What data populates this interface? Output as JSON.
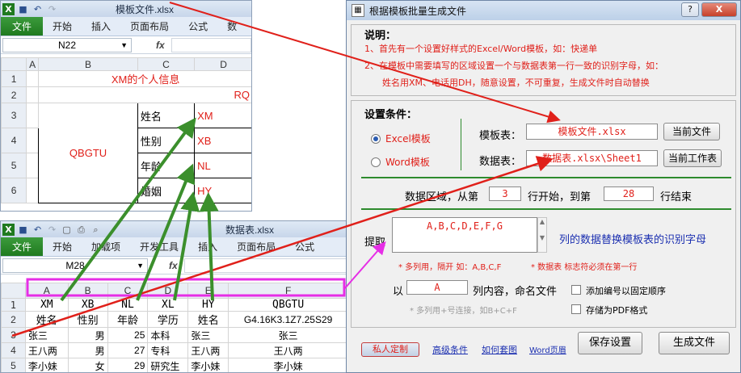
{
  "template_window": {
    "title": "模板文件.xlsx",
    "tabs": [
      "文件",
      "开始",
      "插入",
      "页面布局",
      "公式",
      "数"
    ],
    "name_box": "N22",
    "fx": "fx",
    "col_headers": [
      "",
      "A",
      "B",
      "C",
      "D"
    ],
    "row_headers": [
      "1",
      "2",
      "3",
      "4",
      "5",
      "6"
    ],
    "title_cell": "XM的个人信息",
    "rq_cell": "RQ",
    "photo_cell": "QBGTU",
    "labels": [
      "姓名",
      "性别",
      "年龄",
      "婚姻"
    ],
    "codes": [
      "XM",
      "XB",
      "NL",
      "HY"
    ]
  },
  "data_window": {
    "title": "数据表.xlsx",
    "tabs": [
      "文件",
      "开始",
      "加载项",
      "开发工具",
      "插入",
      "页面布局",
      "公式"
    ],
    "name_box": "M28",
    "fx": "fx",
    "col_headers": [
      "",
      "A",
      "B",
      "C",
      "D",
      "E",
      "F"
    ],
    "rows": [
      {
        "n": "1",
        "cells": [
          "XM",
          "XB",
          "NL",
          "XL",
          "HY",
          "QBGTU"
        ]
      },
      {
        "n": "2",
        "cells": [
          "姓名",
          "性别",
          "年龄",
          "学历",
          "姓名",
          "G4.16K3.1Z7.25S29"
        ]
      },
      {
        "n": "3",
        "cells": [
          "张三",
          "男",
          "25",
          "本科",
          "张三",
          "张三"
        ]
      },
      {
        "n": "4",
        "cells": [
          "王八两",
          "男",
          "27",
          "专科",
          "王八两",
          "王八两"
        ]
      },
      {
        "n": "5",
        "cells": [
          "李小妹",
          "女",
          "29",
          "研究生",
          "李小妹",
          "李小妹"
        ]
      }
    ]
  },
  "dialog": {
    "title": "根据模板批量生成文件",
    "help_btn": "?",
    "close_btn": "X",
    "instructions": {
      "heading": "说明：",
      "line1": "1、首先有一个设置好样式的Excel/Word模板，如：快递单",
      "line2": "2、在模板中需要填写的区域设置一个与数据表第一行一致的识别字母，如：",
      "line3": "姓名用XM、电话用DH，随意设置，不可重复，生成文件时自动替换"
    },
    "settings": {
      "heading": "设置条件：",
      "radio_excel": "Excel模板",
      "radio_word": "Word模板",
      "template_label": "模板表：",
      "template_value": "模板文件.xlsx",
      "current_file_btn": "当前文件",
      "data_label": "数据表：",
      "data_value": "数据表.xlsx\\Sheet1",
      "current_sheet_btn": "当前工作表"
    },
    "range": {
      "prefix": "数据区域，从第",
      "start": "3",
      "middle": "行开始，到第",
      "end": "28",
      "suffix": "行结束"
    },
    "extract": {
      "label": "提取",
      "value": "A,B,C,D,E,F,G",
      "desc": "列的数据替换模板表的识别字母",
      "note1": "* 多列用，隔开 如：A,B,C,F",
      "note2": "* 数据表 标志符必须在第一行"
    },
    "naming": {
      "prefix": "以",
      "value": "A",
      "suffix": "列内容，命名文件",
      "hint": "* 多列用+号连接，如B+C+F",
      "chk_fixed_order": "添加编号以固定顺序",
      "chk_pdf": "存储为PDF格式"
    },
    "footer": {
      "private_btn": "私人定制",
      "link_advanced": "高级条件",
      "link_howto": "如何套图",
      "link_word": "Word页眉",
      "save_btn": "保存设置",
      "generate_btn": "生成文件"
    }
  },
  "colors": {
    "red": "#e0201a",
    "green_arrow": "#3b8f2c",
    "magenta": "#e62ee6",
    "excel_green": "#1f7a1f"
  }
}
